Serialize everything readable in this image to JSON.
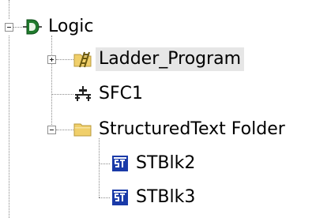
{
  "tree": {
    "root": {
      "label": "Logic",
      "icon": "logic-block-icon",
      "expanded": true,
      "children": [
        {
          "label": "Ladder_Program",
          "icon": "ladder-folder-icon",
          "expanded": false,
          "selected": true
        },
        {
          "label": "SFC1",
          "icon": "sfc-chart-icon"
        },
        {
          "label": "StructuredText Folder",
          "icon": "folder-icon",
          "expanded": true,
          "children": [
            {
              "label": "STBlk2",
              "icon": "st-block-icon"
            },
            {
              "label": "STBlk3",
              "icon": "st-block-icon"
            }
          ]
        }
      ]
    }
  },
  "colors": {
    "logic_icon": "#1f7a2c",
    "folder": "#f0cf6a",
    "ladder_icon": "#6b5a10",
    "st_icon": "#1a3aa8",
    "selection": "#e6e6e6",
    "connector": "#8a8a8a"
  }
}
